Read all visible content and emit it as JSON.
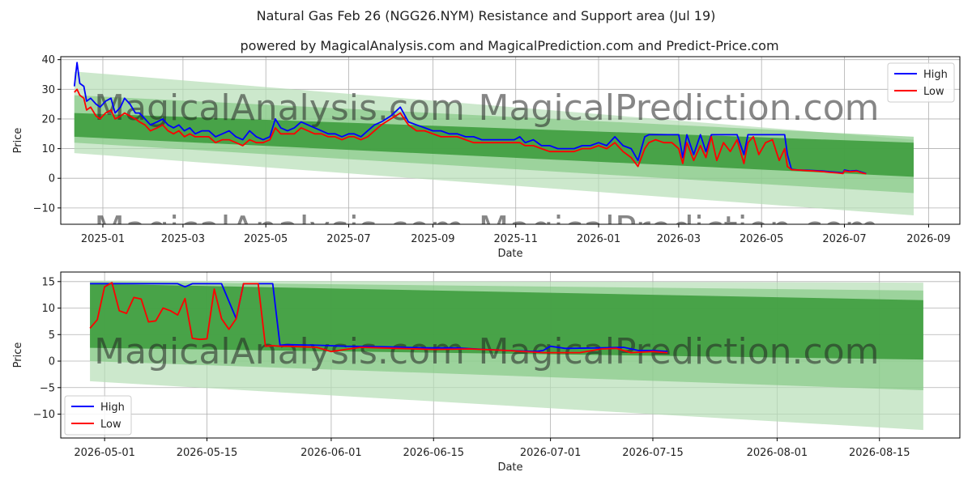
{
  "title": "Natural Gas Feb 26 (NGG26.NYM) Resistance and Support area (Jul 19)",
  "subtitle": "powered by MagicalAnalysis.com and MagicalPrediction.com and Predict-Price.com",
  "watermarks": [
    "MagicalAnalysis.com",
    "MagicalPrediction.com"
  ],
  "colors": {
    "high": "#0000ff",
    "low": "#ff0000",
    "band_dark": "#3a9a3a",
    "band_mid": "#7cc47c",
    "band_light": "#b6deb6",
    "grid": "#b0b0b0",
    "watermark": "#d0d0d0"
  },
  "chart_data": [
    {
      "type": "line",
      "xlabel": "Date",
      "ylabel": "Price",
      "xlim": [
        "2024-12-01",
        "2026-09-24"
      ],
      "ylim": [
        -15.5,
        41
      ],
      "yticks": [
        -10,
        0,
        10,
        20,
        30,
        40
      ],
      "xticks": [
        "2025-01",
        "2025-03",
        "2025-05",
        "2025-07",
        "2025-09",
        "2025-11",
        "2026-01",
        "2026-03",
        "2026-05",
        "2026-07",
        "2026-09"
      ],
      "grid": true,
      "legend": {
        "position": "top-right",
        "entries": [
          "High",
          "Low"
        ]
      },
      "bands": [
        {
          "x": [
            "2024-12-11",
            "2026-08-21"
          ],
          "upper": [
            36,
            13
          ],
          "lower": [
            8.5,
            -12.5
          ],
          "shade": "light"
        },
        {
          "x": [
            "2024-12-11",
            "2026-08-21"
          ],
          "upper": [
            28,
            14
          ],
          "lower": [
            12,
            -5
          ],
          "shade": "mid"
        },
        {
          "x": [
            "2024-12-11",
            "2026-08-21"
          ],
          "upper": [
            22,
            12
          ],
          "lower": [
            14,
            0.5
          ],
          "shade": "dark"
        }
      ],
      "series": [
        {
          "name": "High",
          "x": [
            "2024-12-11",
            "2024-12-13",
            "2024-12-15",
            "2024-12-18",
            "2024-12-20",
            "2024-12-23",
            "2024-12-27",
            "2024-12-30",
            "2025-01-03",
            "2025-01-07",
            "2025-01-10",
            "2025-01-14",
            "2025-01-17",
            "2025-01-21",
            "2025-01-25",
            "2025-01-28",
            "2025-02-01",
            "2025-02-05",
            "2025-02-10",
            "2025-02-14",
            "2025-02-18",
            "2025-02-22",
            "2025-02-26",
            "2025-03-02",
            "2025-03-06",
            "2025-03-10",
            "2025-03-15",
            "2025-03-20",
            "2025-03-25",
            "2025-03-30",
            "2025-04-04",
            "2025-04-09",
            "2025-04-14",
            "2025-04-19",
            "2025-04-24",
            "2025-04-29",
            "2025-05-04",
            "2025-05-08",
            "2025-05-12",
            "2025-05-17",
            "2025-05-22",
            "2025-05-27",
            "2025-06-01",
            "2025-06-06",
            "2025-06-11",
            "2025-06-16",
            "2025-06-21",
            "2025-06-26",
            "2025-07-01",
            "2025-07-05",
            "2025-07-10",
            "2025-07-15",
            "2025-07-20",
            "2025-07-25",
            "2025-08-01",
            "2025-08-08",
            "2025-08-14",
            "2025-08-20",
            "2025-08-26",
            "2025-09-01",
            "2025-09-07",
            "2025-09-13",
            "2025-09-19",
            "2025-09-25",
            "2025-10-01",
            "2025-10-07",
            "2025-10-13",
            "2025-10-19",
            "2025-10-25",
            "2025-10-31",
            "2025-11-04",
            "2025-11-08",
            "2025-11-14",
            "2025-11-20",
            "2025-11-26",
            "2025-12-02",
            "2025-12-08",
            "2025-12-14",
            "2025-12-20",
            "2025-12-26",
            "2026-01-01",
            "2026-01-07",
            "2026-01-13",
            "2026-01-19",
            "2026-01-25",
            "2026-01-30",
            "2026-02-04",
            "2026-02-07",
            "2026-02-12",
            "2026-02-18",
            "2026-02-24",
            "2026-03-01",
            "2026-03-04",
            "2026-03-07",
            "2026-03-12",
            "2026-03-17",
            "2026-03-21",
            "2026-03-25",
            "2026-03-29",
            "2026-04-03",
            "2026-04-08",
            "2026-04-13",
            "2026-04-18",
            "2026-04-21",
            "2026-04-25",
            "2026-04-29",
            "2026-05-04",
            "2026-05-09",
            "2026-05-14",
            "2026-05-18",
            "2026-05-20",
            "2026-05-23",
            "2026-05-28",
            "2026-06-03",
            "2026-06-08",
            "2026-06-14",
            "2026-06-20",
            "2026-06-26",
            "2026-06-30",
            "2026-07-01",
            "2026-07-05",
            "2026-07-10",
            "2026-07-14",
            "2026-07-17"
          ],
          "y": [
            31,
            39,
            32,
            31,
            26,
            27,
            25,
            24,
            26,
            27,
            22,
            24,
            27,
            25,
            22,
            22,
            20,
            18,
            19,
            20,
            18,
            17,
            18,
            16,
            17,
            15,
            16,
            16,
            14,
            15,
            16,
            14,
            13,
            16,
            14,
            13,
            14,
            20,
            17,
            16,
            17,
            19,
            18,
            17,
            16,
            15,
            15,
            14,
            15,
            15,
            14,
            16,
            18,
            19,
            21,
            24,
            19,
            18,
            17,
            16,
            16,
            15,
            15,
            14,
            14,
            13,
            13,
            13,
            13,
            13,
            14,
            12,
            13,
            11,
            11,
            10,
            10,
            10,
            11,
            11,
            12,
            11,
            14,
            11,
            10,
            6,
            14,
            14.7,
            14.7,
            14.7,
            14.7,
            14.7,
            7,
            14.7,
            8,
            14.7,
            9,
            14.7,
            14.7,
            14.7,
            14.7,
            14.7,
            8,
            14.7,
            14.7,
            14.7,
            14.7,
            14.7,
            14.7,
            14.7,
            8,
            3,
            2.8,
            2.7,
            2.6,
            2.5,
            2.2,
            2.0,
            1.8,
            2.8,
            2.4,
            2.6,
            2.0,
            1.6
          ]
        },
        {
          "name": "Low",
          "x": [
            "2024-12-11",
            "2024-12-13",
            "2024-12-15",
            "2024-12-18",
            "2024-12-20",
            "2024-12-23",
            "2024-12-27",
            "2024-12-30",
            "2025-01-03",
            "2025-01-07",
            "2025-01-10",
            "2025-01-14",
            "2025-01-17",
            "2025-01-21",
            "2025-01-25",
            "2025-01-28",
            "2025-02-01",
            "2025-02-05",
            "2025-02-10",
            "2025-02-14",
            "2025-02-18",
            "2025-02-22",
            "2025-02-26",
            "2025-03-02",
            "2025-03-06",
            "2025-03-10",
            "2025-03-15",
            "2025-03-20",
            "2025-03-25",
            "2025-03-30",
            "2025-04-04",
            "2025-04-09",
            "2025-04-14",
            "2025-04-19",
            "2025-04-24",
            "2025-04-29",
            "2025-05-04",
            "2025-05-08",
            "2025-05-12",
            "2025-05-17",
            "2025-05-22",
            "2025-05-27",
            "2025-06-01",
            "2025-06-06",
            "2025-06-11",
            "2025-06-16",
            "2025-06-21",
            "2025-06-26",
            "2025-07-01",
            "2025-07-05",
            "2025-07-10",
            "2025-07-15",
            "2025-07-20",
            "2025-07-25",
            "2025-08-01",
            "2025-08-08",
            "2025-08-14",
            "2025-08-20",
            "2025-08-26",
            "2025-09-01",
            "2025-09-07",
            "2025-09-13",
            "2025-09-19",
            "2025-09-25",
            "2025-10-01",
            "2025-10-07",
            "2025-10-13",
            "2025-10-19",
            "2025-10-25",
            "2025-10-31",
            "2025-11-04",
            "2025-11-08",
            "2025-11-14",
            "2025-11-20",
            "2025-11-26",
            "2025-12-02",
            "2025-12-08",
            "2025-12-14",
            "2025-12-20",
            "2025-12-26",
            "2026-01-01",
            "2026-01-07",
            "2026-01-13",
            "2026-01-19",
            "2026-01-25",
            "2026-01-30",
            "2026-02-04",
            "2026-02-07",
            "2026-02-12",
            "2026-02-18",
            "2026-02-24",
            "2026-03-01",
            "2026-03-04",
            "2026-03-07",
            "2026-03-12",
            "2026-03-17",
            "2026-03-21",
            "2026-03-25",
            "2026-03-29",
            "2026-04-03",
            "2026-04-08",
            "2026-04-13",
            "2026-04-18",
            "2026-04-21",
            "2026-04-25",
            "2026-04-29",
            "2026-05-04",
            "2026-05-09",
            "2026-05-14",
            "2026-05-18",
            "2026-05-20",
            "2026-05-23",
            "2026-05-28",
            "2026-06-03",
            "2026-06-08",
            "2026-06-14",
            "2026-06-20",
            "2026-06-26",
            "2026-06-30",
            "2026-07-01",
            "2026-07-05",
            "2026-07-10",
            "2026-07-14",
            "2026-07-17"
          ],
          "y": [
            29,
            30,
            28,
            27,
            23,
            24,
            21,
            20,
            22,
            23,
            20,
            21,
            22,
            21,
            20,
            19,
            18,
            16,
            17,
            18,
            16,
            15,
            16,
            14,
            15,
            14,
            14,
            14,
            12,
            13,
            13,
            12,
            11,
            13,
            12,
            12,
            13,
            17,
            15,
            15,
            15,
            17,
            16,
            15,
            15,
            14,
            14,
            13,
            14,
            14,
            13,
            14,
            16,
            18,
            20,
            22,
            18,
            16,
            16,
            15,
            14,
            14,
            14,
            13,
            12,
            12,
            12,
            12,
            12,
            12,
            12,
            11,
            11,
            10,
            9,
            9,
            9,
            9,
            10,
            10,
            11,
            10,
            12,
            9,
            7,
            4,
            10,
            12,
            13,
            12,
            12,
            10,
            5,
            12,
            6,
            11,
            7,
            14,
            6,
            12,
            9,
            13,
            5,
            12,
            14,
            8,
            12,
            13,
            6,
            10,
            4,
            2.9,
            2.8,
            2.6,
            2.5,
            2.3,
            2.0,
            1.8,
            1.6,
            2.5,
            2.2,
            2.4,
            1.8,
            1.5
          ]
        }
      ]
    },
    {
      "type": "line",
      "xlabel": "Date",
      "ylabel": "Price",
      "xlim": [
        "2026-04-25",
        "2026-08-26"
      ],
      "ylim": [
        -14.5,
        16.8
      ],
      "yticks": [
        -10,
        -5,
        0,
        5,
        10,
        15
      ],
      "xticks": [
        "2026-05-01",
        "2026-05-15",
        "2026-06-01",
        "2026-06-15",
        "2026-07-01",
        "2026-07-15",
        "2026-08-01",
        "2026-08-15"
      ],
      "grid": true,
      "legend": {
        "position": "bottom-left",
        "entries": [
          "High",
          "Low"
        ]
      },
      "bands": [
        {
          "x": [
            "2026-04-29",
            "2026-08-21"
          ],
          "upper": [
            15.2,
            14.8
          ],
          "lower": [
            -3.8,
            -13
          ],
          "shade": "light"
        },
        {
          "x": [
            "2026-04-29",
            "2026-08-21"
          ],
          "upper": [
            15.0,
            13.3
          ],
          "lower": [
            0,
            -5.5
          ],
          "shade": "mid"
        },
        {
          "x": [
            "2026-04-29",
            "2026-08-21"
          ],
          "upper": [
            14.6,
            11.5
          ],
          "lower": [
            2.5,
            0.3
          ],
          "shade": "dark"
        }
      ],
      "series": [
        {
          "name": "High",
          "x": [
            "2026-04-29",
            "2026-05-02",
            "2026-05-05",
            "2026-05-08",
            "2026-05-11",
            "2026-05-12",
            "2026-05-13",
            "2026-05-14",
            "2026-05-17",
            "2026-05-19",
            "2026-05-20",
            "2026-05-21",
            "2026-05-22",
            "2026-05-23",
            "2026-05-24",
            "2026-05-25",
            "2026-05-26",
            "2026-05-30",
            "2026-06-03",
            "2026-06-08",
            "2026-06-14",
            "2026-06-18",
            "2026-06-22",
            "2026-06-25",
            "2026-06-29",
            "2026-06-30",
            "2026-07-01",
            "2026-07-03",
            "2026-07-08",
            "2026-07-11",
            "2026-07-13",
            "2026-07-15",
            "2026-07-17"
          ],
          "y": [
            14.6,
            14.6,
            14.6,
            14.6,
            14.6,
            14.0,
            14.6,
            14.6,
            14.6,
            8,
            14.6,
            14.6,
            14.6,
            14.6,
            14.6,
            3,
            3.1,
            3.0,
            2.8,
            2.7,
            2.5,
            2.5,
            2.2,
            2.0,
            1.8,
            2.0,
            2.8,
            2.4,
            2.5,
            2.6,
            2.0,
            2.0,
            1.8
          ]
        },
        {
          "name": "Low",
          "x": [
            "2026-04-29",
            "2026-04-30",
            "2026-05-01",
            "2026-05-02",
            "2026-05-03",
            "2026-05-04",
            "2026-05-05",
            "2026-05-06",
            "2026-05-07",
            "2026-05-08",
            "2026-05-09",
            "2026-05-10",
            "2026-05-11",
            "2026-05-12",
            "2026-05-13",
            "2026-05-14",
            "2026-05-15",
            "2026-05-16",
            "2026-05-17",
            "2026-05-18",
            "2026-05-19",
            "2026-05-20",
            "2026-05-21",
            "2026-05-22",
            "2026-05-23",
            "2026-05-24",
            "2026-05-25",
            "2026-05-26",
            "2026-05-30",
            "2026-06-01",
            "2026-06-05",
            "2026-06-10",
            "2026-06-15",
            "2026-06-20",
            "2026-06-25",
            "2026-06-30",
            "2026-07-05",
            "2026-07-08",
            "2026-07-10",
            "2026-07-12",
            "2026-07-15",
            "2026-07-17"
          ],
          "y": [
            6.2,
            7.8,
            14.0,
            14.8,
            9.5,
            9.0,
            12,
            11.7,
            7.4,
            7.6,
            10,
            9.5,
            8.7,
            11.8,
            4.3,
            4.1,
            4.2,
            13.6,
            8,
            6,
            8,
            14.6,
            14.6,
            14.6,
            2.8,
            2.9,
            2.8,
            2.8,
            2.6,
            1.8,
            2.6,
            2.4,
            2.2,
            2.3,
            2.0,
            1.6,
            1.6,
            2.3,
            2.4,
            1.6,
            1.8,
            1.6
          ]
        }
      ]
    }
  ]
}
